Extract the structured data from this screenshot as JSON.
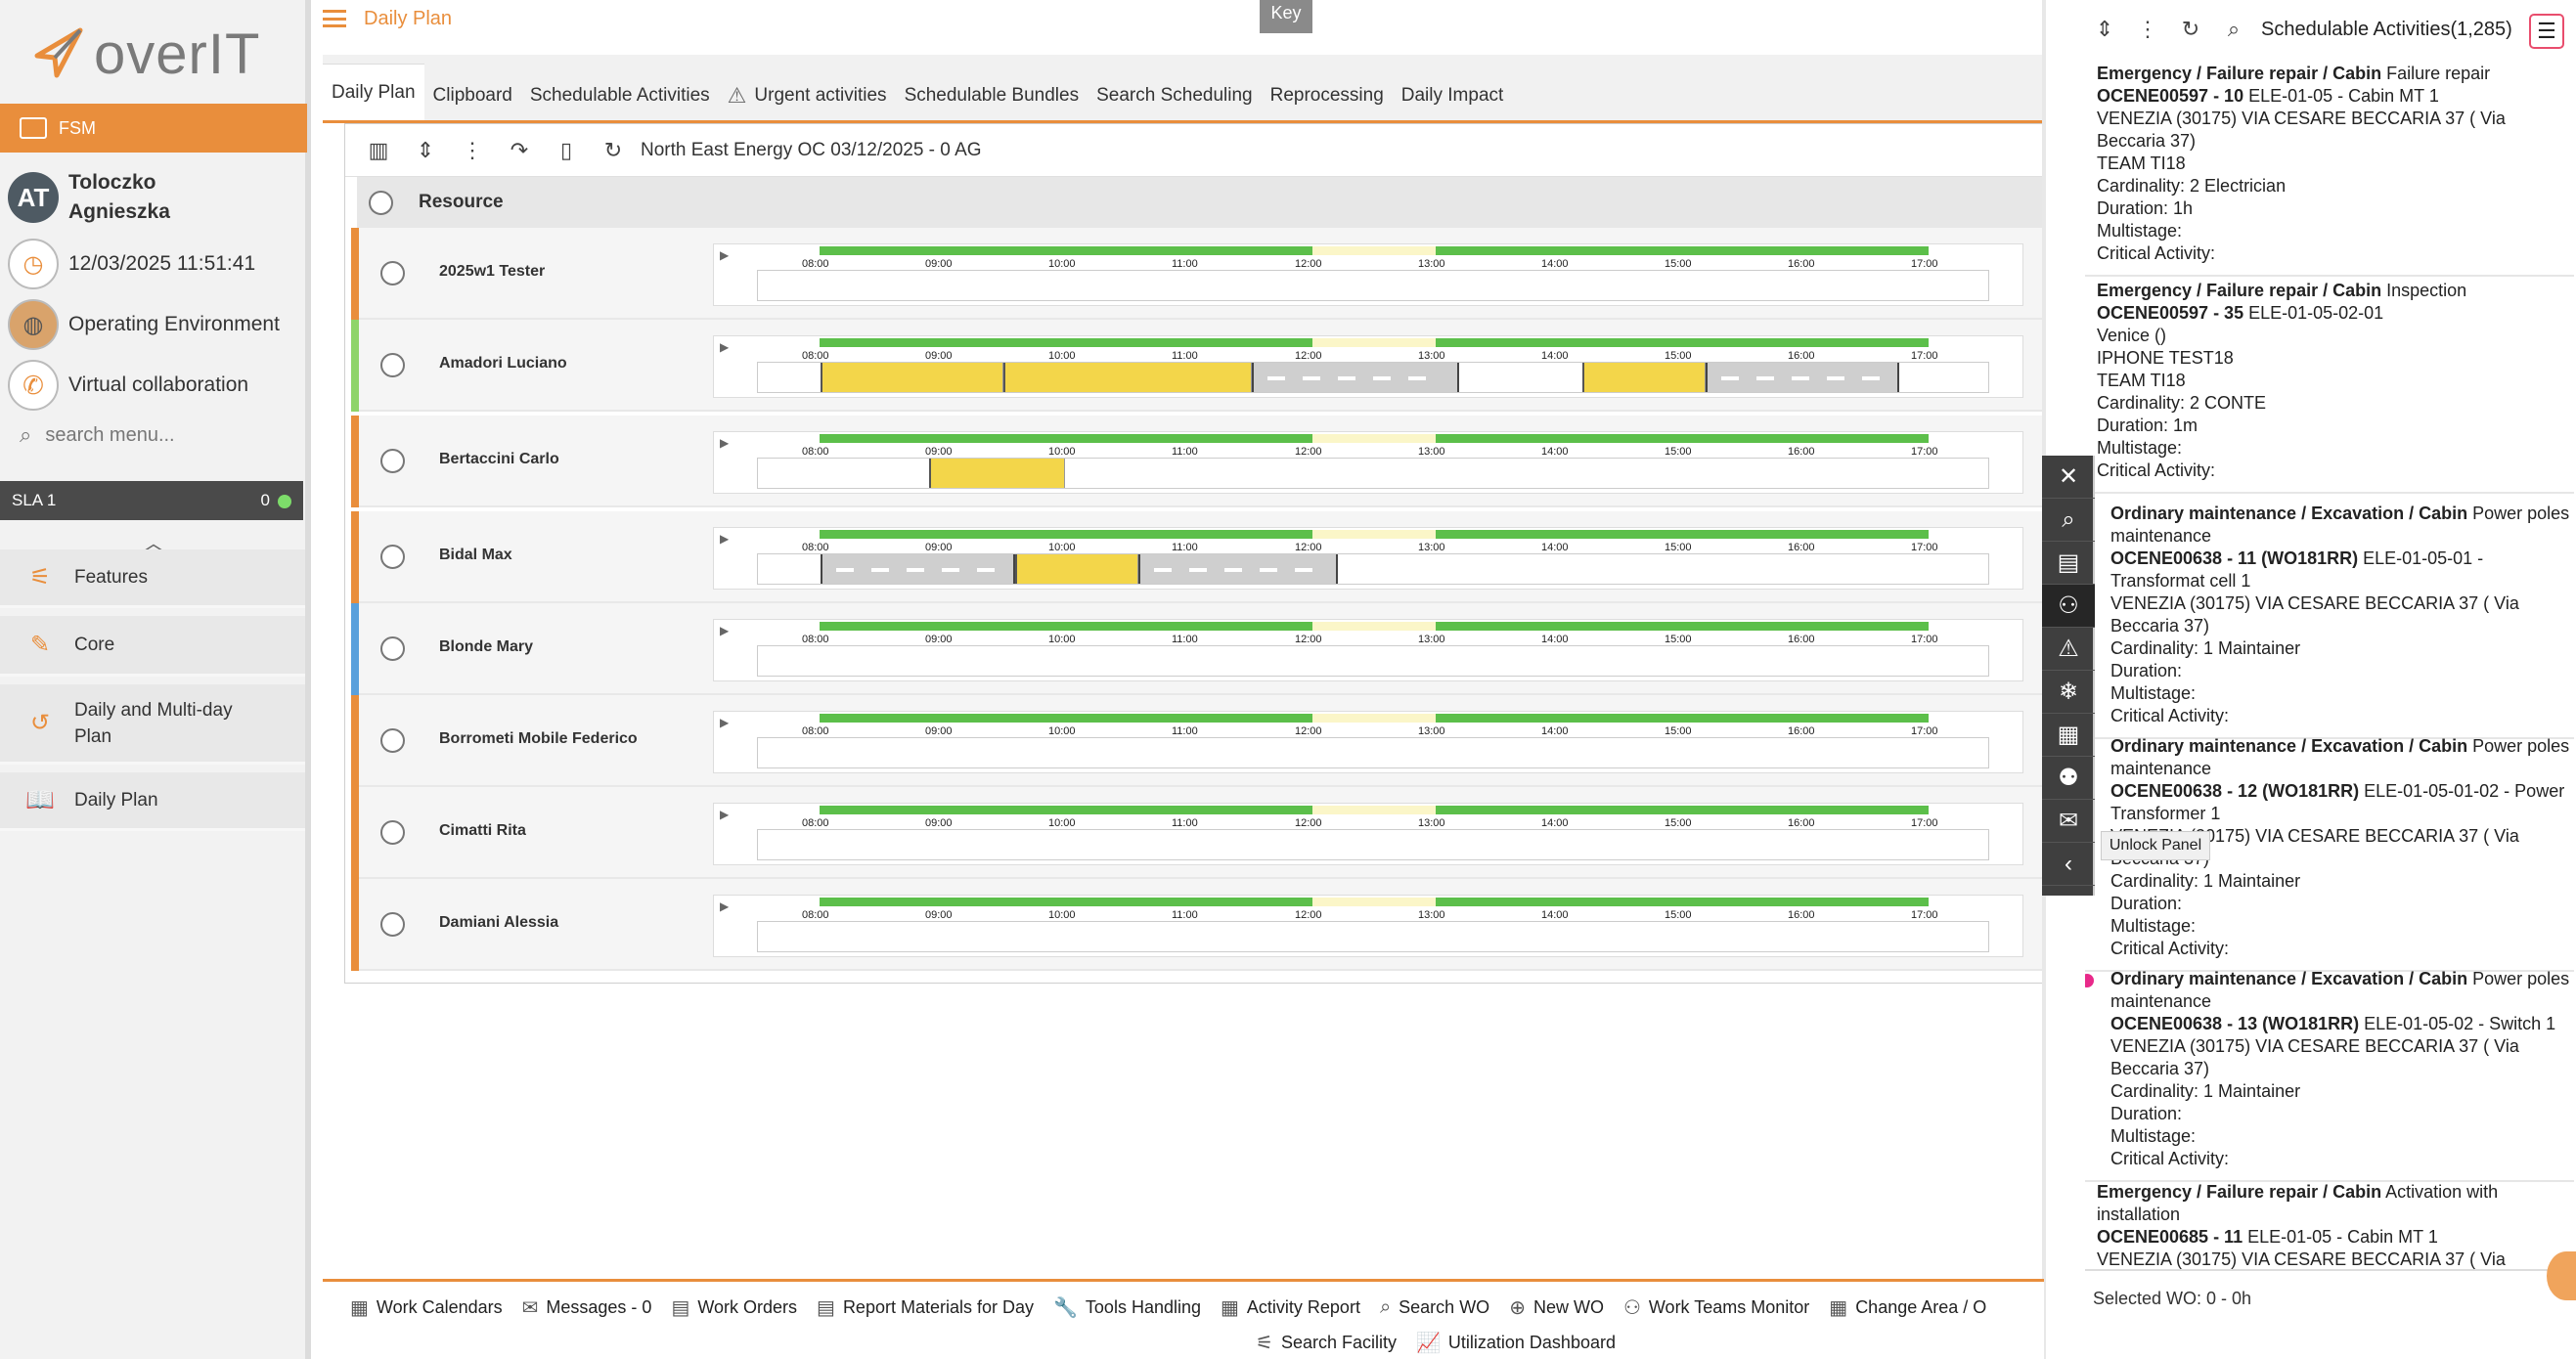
{
  "app": {
    "brand": "overIT",
    "section": "FSM"
  },
  "sidebar": {
    "user_initials": "AT",
    "user_name_1": "Toloczko",
    "user_name_2": "Agnieszka",
    "datetime": "12/03/2025 11:51:41",
    "operating_env": "Operating Environment",
    "virtual_collab": "Virtual collaboration",
    "search_placeholder": "search menu...",
    "sla_label": "SLA 1",
    "sla_count": "0",
    "menu": [
      {
        "label": "Features",
        "icon": "features-icon"
      },
      {
        "label": "Core",
        "icon": "core-icon"
      },
      {
        "label": "Daily and Multi-day Plan",
        "icon": "history-icon"
      },
      {
        "label": "Daily Plan",
        "icon": "book-icon"
      }
    ]
  },
  "header": {
    "title": "Daily Plan",
    "key_label": "Key"
  },
  "tabs": [
    "Daily Plan",
    "Clipboard",
    "Schedulable Activities",
    "Urgent activities",
    "Schedulable Bundles",
    "Search Scheduling",
    "Reprocessing",
    "Daily Impact"
  ],
  "plan": {
    "toolbar_text": "North East Energy OC 03/12/2025 - 0 AG",
    "resource_header": "Resource",
    "hours": [
      "08:00",
      "09:00",
      "10:00",
      "11:00",
      "12:00",
      "13:00",
      "14:00",
      "15:00",
      "16:00",
      "17:00"
    ],
    "resources": [
      {
        "name": "2025w1 Tester",
        "color": "#e98e3c"
      },
      {
        "name": "Amadori Luciano",
        "color": "#8fd46a"
      },
      {
        "name": "Bertaccini Carlo",
        "color": "#e98e3c"
      },
      {
        "name": "Bidal Max",
        "color": "#e98e3c"
      },
      {
        "name": "Blonde Mary",
        "color": "#5aa0dc"
      },
      {
        "name": "Borrometi Mobile Federico",
        "color": "#e98e3c"
      },
      {
        "name": "Cimatti Rita",
        "color": "#e98e3c"
      },
      {
        "name": "Damiani Alessia",
        "color": "#e98e3c"
      }
    ]
  },
  "right_panel": {
    "title": "Schedulable Activities(1,285)",
    "selected_wo": "Selected WO: 0 - 0h",
    "tooltip": "Unlock Panel",
    "cards": [
      {
        "head_b": "Emergency / Failure repair / Cabin",
        "head_r": " Failure repair",
        "code_b": "OCENE00597 - 10",
        "code_r": " ELE-01-05 - Cabin MT 1",
        "lines": [
          "VENEZIA (30175) VIA CESARE BECCARIA 37 ( Via Beccaria 37)",
          "TEAM TI18",
          "Cardinality: 2 Electrician",
          "Duration: 1h",
          "Multistage:",
          "Critical Activity:"
        ]
      },
      {
        "head_b": "Emergency / Failure repair / Cabin",
        "head_r": " Inspection",
        "code_b": "OCENE00597 - 35",
        "code_r": " ELE-01-05-02-01",
        "lines": [
          "Venice ()",
          "IPHONE TEST18",
          "TEAM TI18",
          "Cardinality: 2 CONTE",
          "Duration: 1m",
          "Multistage:",
          "Critical Activity:"
        ]
      },
      {
        "head_b": "Ordinary maintenance / Excavation / Cabin",
        "head_r": " Power poles maintenance",
        "code_b": "OCENE00638 - 11 (WO181RR)",
        "code_r": " ELE-01-05-01 - Transformat cell 1",
        "lines": [
          "VENEZIA (30175) VIA CESARE BECCARIA 37 ( Via Beccaria 37)",
          "Cardinality: 1 Maintainer",
          "Duration:",
          "Multistage:",
          "Critical Activity:"
        ]
      },
      {
        "head_b": "Ordinary maintenance / Excavation / Cabin",
        "head_r": " Power poles maintenance",
        "code_b": "OCENE00638 - 12 (WO181RR)",
        "code_r": " ELE-01-05-01-02 - Power Transformer 1",
        "lines": [
          "VENEZIA (30175) VIA CESARE BECCARIA 37 ( Via Beccaria 37)",
          "Cardinality: 1 Maintainer",
          "Duration:",
          "Multistage:",
          "Critical Activity:"
        ]
      },
      {
        "head_b": "Ordinary maintenance / Excavation / Cabin",
        "head_r": " Power poles maintenance",
        "code_b": "OCENE00638 - 13 (WO181RR)",
        "code_r": " ELE-01-05-02 - Switch 1",
        "lines": [
          "VENEZIA (30175) VIA CESARE BECCARIA 37 ( Via Beccaria 37)",
          "Cardinality: 1 Maintainer",
          "Duration:",
          "Multistage:",
          "Critical Activity:"
        ]
      },
      {
        "head_b": "Emergency / Failure repair / Cabin",
        "head_r": " Activation with installation",
        "code_b": "OCENE00685 - 11",
        "code_r": " ELE-01-05 - Cabin MT 1",
        "lines": [
          "VENEZIA (30175) VIA CESARE BECCARIA 37 ( Via"
        ]
      }
    ]
  },
  "bottom": {
    "row1": [
      "Work Calendars",
      "Messages - 0",
      "Work Orders",
      "Report Materials for Day",
      "Tools Handling",
      "Activity Report",
      "Search WO",
      "New WO",
      "Work Teams Monitor",
      "Change Area / O"
    ],
    "row2": [
      "Search Facility",
      "Utilization Dashboard"
    ]
  },
  "colors": {
    "accent": "#e98e3c",
    "available": "#5cbf4a",
    "activity": "#f3d64a",
    "urgent_dot": "#e82a8a"
  }
}
